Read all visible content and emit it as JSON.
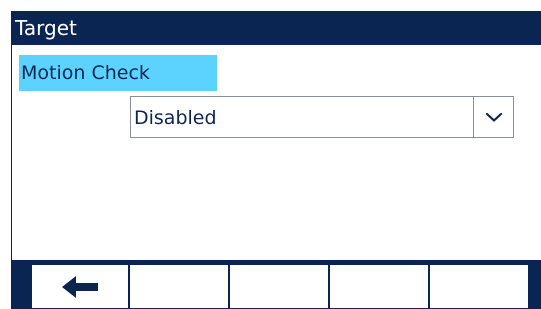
{
  "window": {
    "title": "Target"
  },
  "form": {
    "field_label": "Motion Check",
    "select_value": "Disabled",
    "select_icon": "chevron-down-icon"
  },
  "softkeys": [
    {
      "name": "back",
      "icon": "arrow-left-icon"
    },
    {
      "name": "softkey-2",
      "icon": ""
    },
    {
      "name": "softkey-3",
      "icon": ""
    },
    {
      "name": "softkey-4",
      "icon": ""
    },
    {
      "name": "softkey-5",
      "icon": ""
    }
  ],
  "colors": {
    "header_bg": "#0b2553",
    "label_highlight": "#5cd3ff",
    "text_primary": "#0b2553"
  }
}
